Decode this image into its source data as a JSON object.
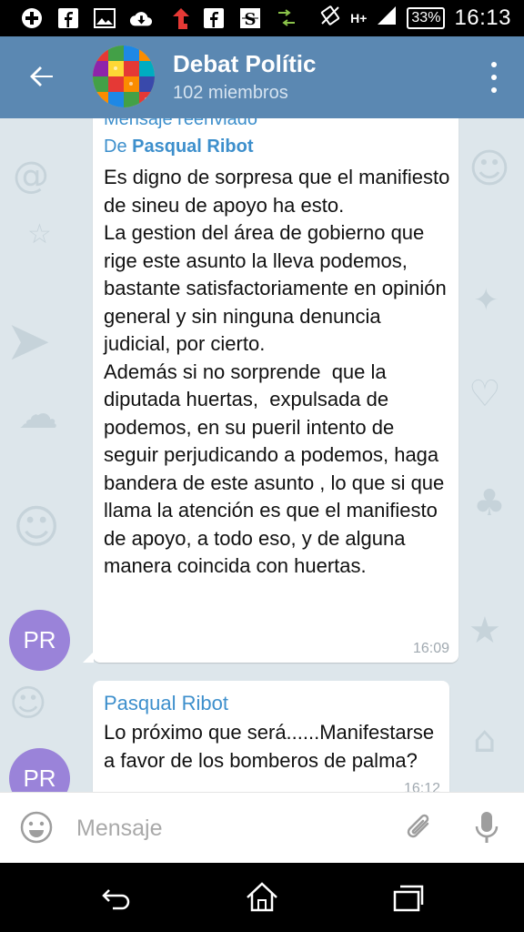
{
  "status_bar": {
    "time": "16:13",
    "battery": "33%",
    "network": "H+",
    "left_icons": [
      "plus-icon",
      "facebook-icon",
      "image-icon",
      "cloud-download-icon",
      "red-arrow-icon",
      "facebook-icon",
      "s-app-icon",
      "data-transfer-icon"
    ]
  },
  "header": {
    "title": "Debat Polític",
    "subtitle": "102 miembros",
    "accent": "#5b88b2"
  },
  "messages": [
    {
      "forward_label": "Mensaje reenviado",
      "forward_prefix": "De",
      "forward_name": "Pasqual Ribot",
      "text": "Es digno de sorpresa que el manifiesto de sineu de apoyo ha esto.\nLa gestion del área de gobierno que rige este asunto la lleva podemos, bastante satisfactoriamente en opinión general y sin ninguna denuncia judicial, por cierto.\nAdemás si no sorprende  que la diputada huertas,  expulsada de podemos, en su pueril intento de seguir perjudicando a podemos, haga bandera de este asunto , lo que si que llama la atención es que el manifiesto de apoyo, a todo eso, y de alguna manera coincida con huertas.",
      "time": "16:09",
      "avatar_initials": "PR"
    },
    {
      "sender": "Pasqual Ribot",
      "text": "Lo próximo que será......Manifestarse a favor de los bomberos de palma?",
      "time": "16:12",
      "avatar_initials": "PR"
    }
  ],
  "input": {
    "placeholder": "Mensaje"
  },
  "nav": [
    "back-icon",
    "home-icon",
    "recent-apps-icon"
  ]
}
